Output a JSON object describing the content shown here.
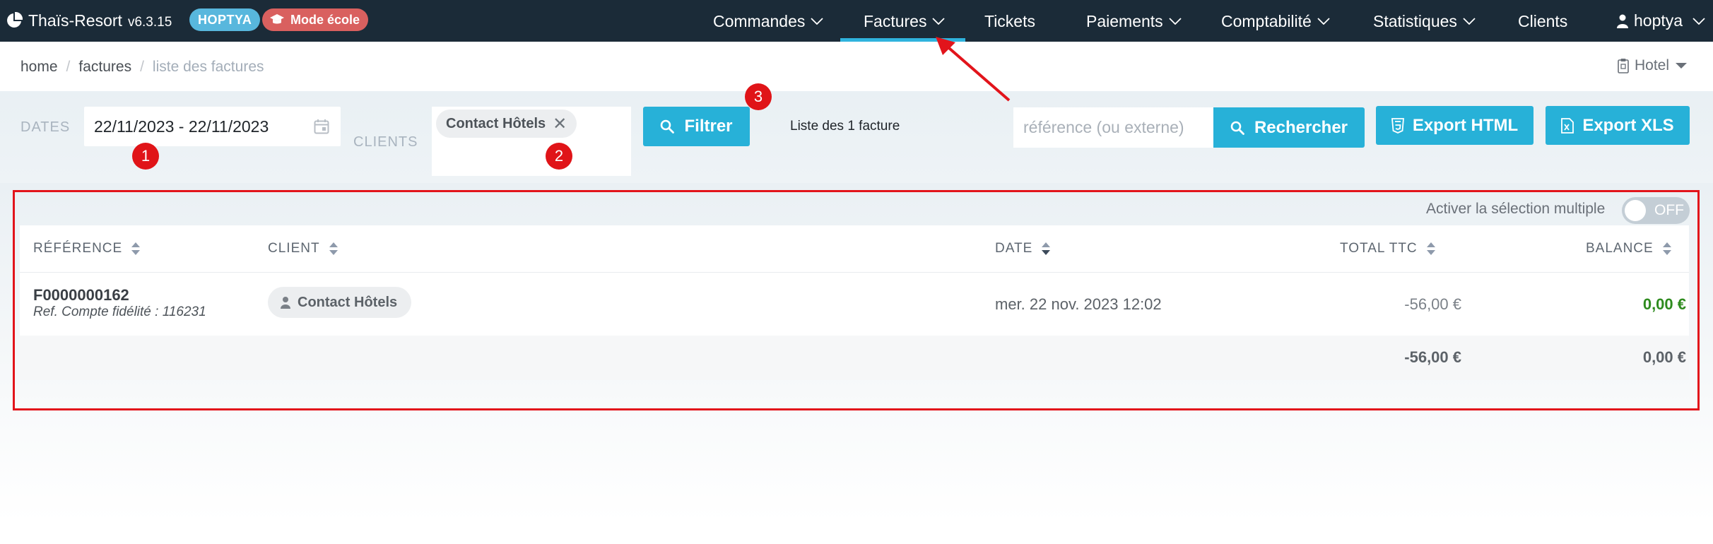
{
  "navbar": {
    "brand": "Thaïs-Resort",
    "version": "v6.3.15",
    "badge_account": "HOPTYA",
    "badge_mode": "Mode école",
    "items": [
      {
        "label": "Commandes"
      },
      {
        "label": "Factures"
      },
      {
        "label": "Tickets"
      },
      {
        "label": "Paiements"
      },
      {
        "label": "Comptabilité"
      },
      {
        "label": "Statistiques"
      },
      {
        "label": "Clients"
      }
    ],
    "user": "hoptya"
  },
  "breadcrumb": {
    "items": [
      "home",
      "factures"
    ],
    "current": "liste des factures"
  },
  "hotel_selector": "Hotel",
  "filters": {
    "dates_label": "DATES",
    "dates_value": "22/11/2023 - 22/11/2023",
    "clients_label": "CLIENTS",
    "client_chip": "Contact Hôtels",
    "filter_button": "Filtrer",
    "count_text": "Liste des 1 facture",
    "search_placeholder": "référence (ou externe)",
    "search_button": "Rechercher",
    "export_html": "Export HTML",
    "export_xls": "Export XLS"
  },
  "annotations": {
    "markers": [
      "1",
      "2",
      "3"
    ]
  },
  "table": {
    "multi_select_label": "Activer la sélection multiple",
    "toggle_state": "OFF",
    "columns": [
      "RÉFÉRENCE",
      "CLIENT",
      "DATE",
      "TOTAL TTC",
      "BALANCE"
    ],
    "rows": [
      {
        "reference": "F0000000162",
        "reference_sub": "Ref. Compte fidélité : 116231",
        "client": "Contact Hôtels",
        "date": "mer. 22 nov. 2023 12:02",
        "total_ttc": "-56,00 €",
        "balance": "0,00 €"
      }
    ],
    "totals": {
      "total_ttc": "-56,00 €",
      "balance": "0,00 €"
    }
  },
  "colors": {
    "navbar_bg": "#1b2b38",
    "accent": "#27b1d8",
    "badge_account": "#58b7dd",
    "badge_mode": "#d9605f",
    "balance_positive": "#2e8b1e",
    "annotation_red": "#e2141b"
  }
}
